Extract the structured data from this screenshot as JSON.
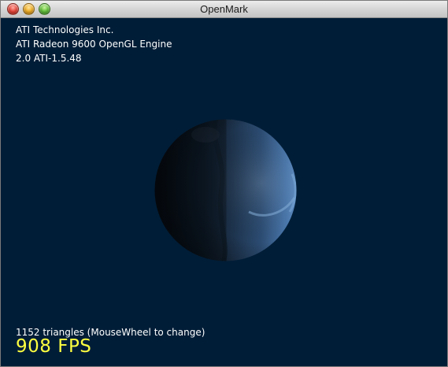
{
  "window": {
    "title": "OpenMark"
  },
  "renderer": {
    "vendor": "ATI Technologies Inc.",
    "renderer": "ATI Radeon 9600 OpenGL Engine",
    "version": "2.0 ATI-1.5.48"
  },
  "stats": {
    "triangles_text": "1152 triangles (MouseWheel to change)",
    "fps_text": "908 FPS"
  },
  "colors": {
    "background": "#001d37",
    "info_text": "#ffffff",
    "fps_text": "#ffff40"
  }
}
